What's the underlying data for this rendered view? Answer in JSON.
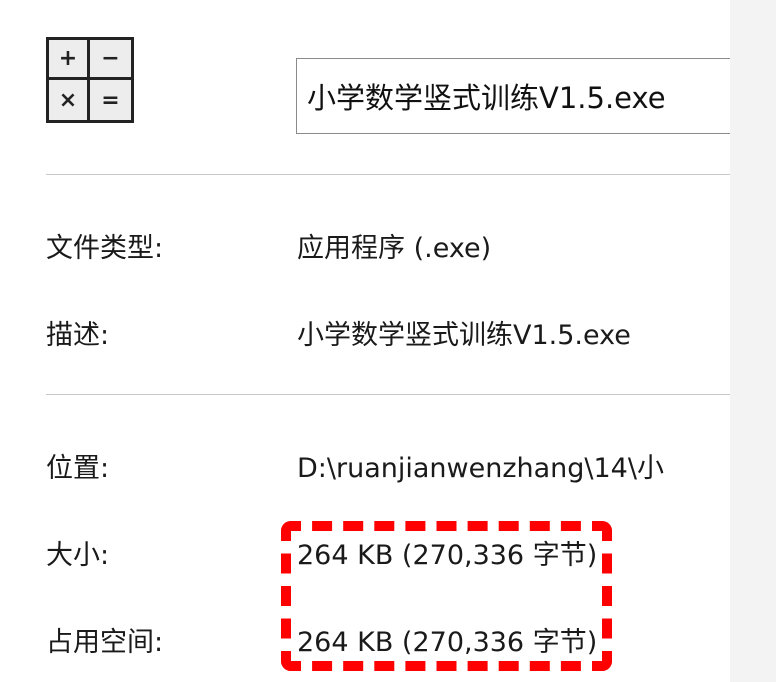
{
  "icon": {
    "name": "calculator-icon",
    "symbols": [
      "+",
      "−",
      "×",
      "="
    ]
  },
  "filename": "小学数学竖式训练V1.5.exe",
  "rows": [
    {
      "label": "文件类型:",
      "value": "应用程序 (.exe)"
    },
    {
      "label": "描述:",
      "value": "小学数学竖式训练V1.5.exe"
    },
    {
      "label": "位置:",
      "value": "D:\\ruanjianwenzhang\\14\\小"
    },
    {
      "label": "大小:",
      "value": "264 KB (270,336 字节)"
    },
    {
      "label": "占用空间:",
      "value": "264 KB (270,336 字节)"
    }
  ],
  "colors": {
    "highlight": "#ff0000"
  }
}
